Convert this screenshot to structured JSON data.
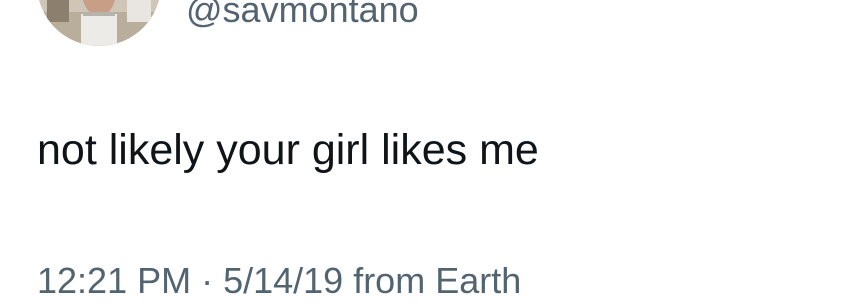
{
  "author": {
    "handle": "@savmontano",
    "avatar_icon": "profile-photo"
  },
  "tweet": {
    "text": "not likely your girl likes me",
    "meta": "12:21 PM · 5/14/19 from Earth"
  },
  "colors": {
    "primary_text": "#0f1419",
    "secondary_text": "#536471",
    "background": "#ffffff"
  }
}
